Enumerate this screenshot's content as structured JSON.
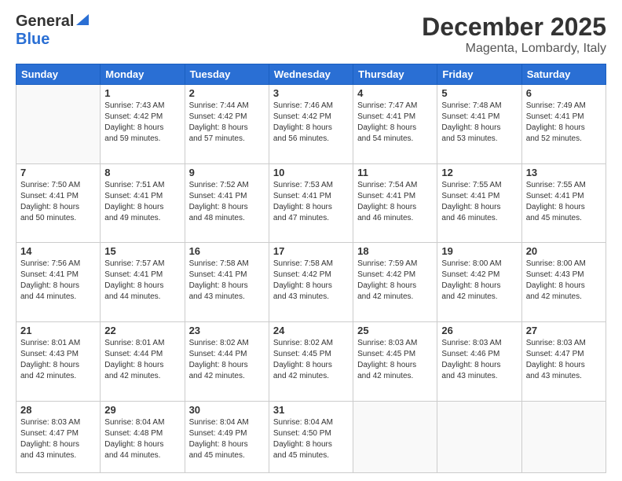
{
  "header": {
    "logo_general": "General",
    "logo_blue": "Blue",
    "title": "December 2025",
    "location": "Magenta, Lombardy, Italy"
  },
  "weekdays": [
    "Sunday",
    "Monday",
    "Tuesday",
    "Wednesday",
    "Thursday",
    "Friday",
    "Saturday"
  ],
  "weeks": [
    [
      {
        "day": "",
        "info": ""
      },
      {
        "day": "1",
        "info": "Sunrise: 7:43 AM\nSunset: 4:42 PM\nDaylight: 8 hours\nand 59 minutes."
      },
      {
        "day": "2",
        "info": "Sunrise: 7:44 AM\nSunset: 4:42 PM\nDaylight: 8 hours\nand 57 minutes."
      },
      {
        "day": "3",
        "info": "Sunrise: 7:46 AM\nSunset: 4:42 PM\nDaylight: 8 hours\nand 56 minutes."
      },
      {
        "day": "4",
        "info": "Sunrise: 7:47 AM\nSunset: 4:41 PM\nDaylight: 8 hours\nand 54 minutes."
      },
      {
        "day": "5",
        "info": "Sunrise: 7:48 AM\nSunset: 4:41 PM\nDaylight: 8 hours\nand 53 minutes."
      },
      {
        "day": "6",
        "info": "Sunrise: 7:49 AM\nSunset: 4:41 PM\nDaylight: 8 hours\nand 52 minutes."
      }
    ],
    [
      {
        "day": "7",
        "info": "Sunrise: 7:50 AM\nSunset: 4:41 PM\nDaylight: 8 hours\nand 50 minutes."
      },
      {
        "day": "8",
        "info": "Sunrise: 7:51 AM\nSunset: 4:41 PM\nDaylight: 8 hours\nand 49 minutes."
      },
      {
        "day": "9",
        "info": "Sunrise: 7:52 AM\nSunset: 4:41 PM\nDaylight: 8 hours\nand 48 minutes."
      },
      {
        "day": "10",
        "info": "Sunrise: 7:53 AM\nSunset: 4:41 PM\nDaylight: 8 hours\nand 47 minutes."
      },
      {
        "day": "11",
        "info": "Sunrise: 7:54 AM\nSunset: 4:41 PM\nDaylight: 8 hours\nand 46 minutes."
      },
      {
        "day": "12",
        "info": "Sunrise: 7:55 AM\nSunset: 4:41 PM\nDaylight: 8 hours\nand 46 minutes."
      },
      {
        "day": "13",
        "info": "Sunrise: 7:55 AM\nSunset: 4:41 PM\nDaylight: 8 hours\nand 45 minutes."
      }
    ],
    [
      {
        "day": "14",
        "info": "Sunrise: 7:56 AM\nSunset: 4:41 PM\nDaylight: 8 hours\nand 44 minutes."
      },
      {
        "day": "15",
        "info": "Sunrise: 7:57 AM\nSunset: 4:41 PM\nDaylight: 8 hours\nand 44 minutes."
      },
      {
        "day": "16",
        "info": "Sunrise: 7:58 AM\nSunset: 4:41 PM\nDaylight: 8 hours\nand 43 minutes."
      },
      {
        "day": "17",
        "info": "Sunrise: 7:58 AM\nSunset: 4:42 PM\nDaylight: 8 hours\nand 43 minutes."
      },
      {
        "day": "18",
        "info": "Sunrise: 7:59 AM\nSunset: 4:42 PM\nDaylight: 8 hours\nand 42 minutes."
      },
      {
        "day": "19",
        "info": "Sunrise: 8:00 AM\nSunset: 4:42 PM\nDaylight: 8 hours\nand 42 minutes."
      },
      {
        "day": "20",
        "info": "Sunrise: 8:00 AM\nSunset: 4:43 PM\nDaylight: 8 hours\nand 42 minutes."
      }
    ],
    [
      {
        "day": "21",
        "info": "Sunrise: 8:01 AM\nSunset: 4:43 PM\nDaylight: 8 hours\nand 42 minutes."
      },
      {
        "day": "22",
        "info": "Sunrise: 8:01 AM\nSunset: 4:44 PM\nDaylight: 8 hours\nand 42 minutes."
      },
      {
        "day": "23",
        "info": "Sunrise: 8:02 AM\nSunset: 4:44 PM\nDaylight: 8 hours\nand 42 minutes."
      },
      {
        "day": "24",
        "info": "Sunrise: 8:02 AM\nSunset: 4:45 PM\nDaylight: 8 hours\nand 42 minutes."
      },
      {
        "day": "25",
        "info": "Sunrise: 8:03 AM\nSunset: 4:45 PM\nDaylight: 8 hours\nand 42 minutes."
      },
      {
        "day": "26",
        "info": "Sunrise: 8:03 AM\nSunset: 4:46 PM\nDaylight: 8 hours\nand 43 minutes."
      },
      {
        "day": "27",
        "info": "Sunrise: 8:03 AM\nSunset: 4:47 PM\nDaylight: 8 hours\nand 43 minutes."
      }
    ],
    [
      {
        "day": "28",
        "info": "Sunrise: 8:03 AM\nSunset: 4:47 PM\nDaylight: 8 hours\nand 43 minutes."
      },
      {
        "day": "29",
        "info": "Sunrise: 8:04 AM\nSunset: 4:48 PM\nDaylight: 8 hours\nand 44 minutes."
      },
      {
        "day": "30",
        "info": "Sunrise: 8:04 AM\nSunset: 4:49 PM\nDaylight: 8 hours\nand 45 minutes."
      },
      {
        "day": "31",
        "info": "Sunrise: 8:04 AM\nSunset: 4:50 PM\nDaylight: 8 hours\nand 45 minutes."
      },
      {
        "day": "",
        "info": ""
      },
      {
        "day": "",
        "info": ""
      },
      {
        "day": "",
        "info": ""
      }
    ]
  ]
}
